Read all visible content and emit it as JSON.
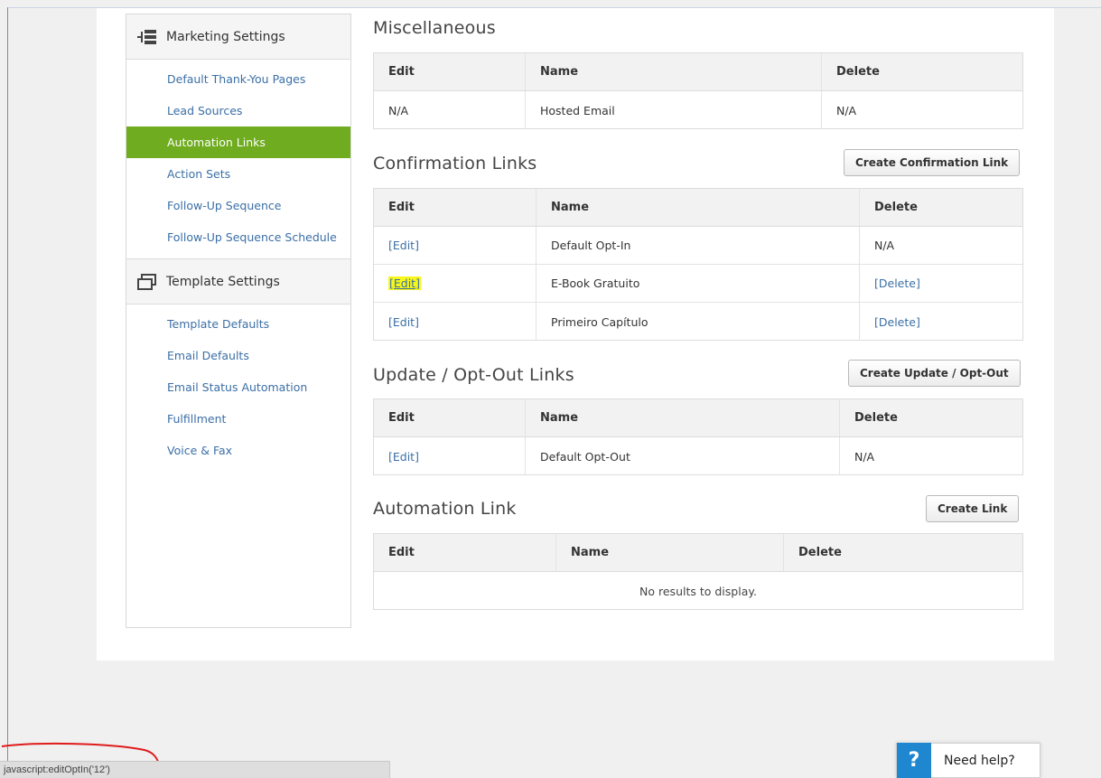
{
  "sidebar": {
    "marketing": {
      "title": "Marketing Settings",
      "items": [
        {
          "label": "Default Thank-You Pages",
          "active": false
        },
        {
          "label": "Lead Sources",
          "active": false
        },
        {
          "label": "Automation Links",
          "active": true
        },
        {
          "label": "Action Sets",
          "active": false
        },
        {
          "label": "Follow-Up Sequence",
          "active": false
        },
        {
          "label": "Follow-Up Sequence Schedule",
          "active": false
        }
      ]
    },
    "template": {
      "title": "Template Settings",
      "items": [
        {
          "label": "Template Defaults"
        },
        {
          "label": "Email Defaults"
        },
        {
          "label": "Email Status Automation"
        },
        {
          "label": "Fulfillment"
        },
        {
          "label": "Voice & Fax"
        }
      ]
    }
  },
  "miscellaneous": {
    "title": "Miscellaneous",
    "headers": [
      "Edit",
      "Name",
      "Delete"
    ],
    "rows": [
      [
        "N/A",
        "Hosted Email",
        "N/A"
      ]
    ]
  },
  "confirmation": {
    "title": "Confirmation Links",
    "button": "Create Confirmation Link",
    "headers": [
      "Edit",
      "Name",
      "Delete"
    ],
    "rows": [
      [
        "[Edit]",
        "Default Opt-In",
        "N/A"
      ],
      [
        "[Edit]",
        "E-Book Gratuito",
        "[Delete]"
      ],
      [
        "[Edit]",
        "Primeiro Capítulo",
        "[Delete]"
      ]
    ]
  },
  "optout": {
    "title": "Update / Opt-Out Links",
    "button": "Create Update / Opt-Out",
    "headers": [
      "Edit",
      "Name",
      "Delete"
    ],
    "rows": [
      [
        "[Edit]",
        "Default Opt-Out",
        "N/A"
      ]
    ]
  },
  "automation": {
    "title": "Automation Link",
    "button": "Create Link",
    "headers": [
      "Edit",
      "Name",
      "Delete"
    ],
    "empty": "No results to display."
  },
  "statusbar": {
    "text": "javascript:editOptIn('12')"
  },
  "help": {
    "label": "Need help?",
    "icon": "?"
  },
  "colors": {
    "active": "#6fac1f",
    "link": "#3b6fa6",
    "highlight": "#f7f71a",
    "help": "#1f86d0"
  }
}
